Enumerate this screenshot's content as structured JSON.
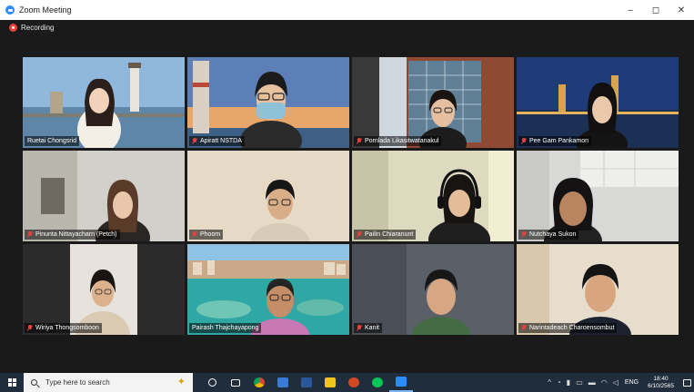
{
  "window": {
    "title": "Zoom Meeting",
    "controls": [
      "–",
      "◻",
      "✕"
    ]
  },
  "meeting": {
    "recording_label": "Recording",
    "active_speaker_color": "#d9e04a",
    "participants": [
      {
        "name": "Ruetai Chongsrid",
        "muted": false,
        "active": false
      },
      {
        "name": "Apiratt NSTDA",
        "muted": true,
        "active": false
      },
      {
        "name": "Pornlada Likasitwatanakul",
        "muted": true,
        "active": false
      },
      {
        "name": "Pee Gam Pankamon",
        "muted": true,
        "active": false
      },
      {
        "name": "Pinunta Nittayacharn (Petch)",
        "muted": true,
        "active": false
      },
      {
        "name": "Phoom",
        "muted": true,
        "active": false
      },
      {
        "name": "Pailin Chiaranunt",
        "muted": true,
        "active": false
      },
      {
        "name": "Nutchaya Sukon",
        "muted": true,
        "active": false
      },
      {
        "name": "Wiriya Thongsomboon",
        "muted": true,
        "active": false
      },
      {
        "name": "Pairash Thajchayapong",
        "muted": false,
        "active": true
      },
      {
        "name": "Kanit",
        "muted": true,
        "active": false
      },
      {
        "name": "Narintadeach Charoensombut",
        "muted": true,
        "active": false
      }
    ]
  },
  "taskbar": {
    "search_placeholder": "Type here to search",
    "apps": [
      {
        "name": "cortana-icon",
        "color": "#ffffff"
      },
      {
        "name": "task-view-icon",
        "color": "#ffffff"
      },
      {
        "name": "chrome-icon",
        "color": "#e8a317"
      },
      {
        "name": "store-icon",
        "color": "#3a7bd5"
      },
      {
        "name": "word-icon",
        "color": "#2b579a"
      },
      {
        "name": "file-explorer-icon",
        "color": "#f0c419"
      },
      {
        "name": "powerpoint-icon",
        "color": "#d24726"
      },
      {
        "name": "line-icon",
        "color": "#06c755"
      },
      {
        "name": "zoom-icon",
        "color": "#2d8cff"
      }
    ],
    "tray": {
      "language": "ENG",
      "time": "18:40",
      "date": "6/10/2565"
    }
  }
}
